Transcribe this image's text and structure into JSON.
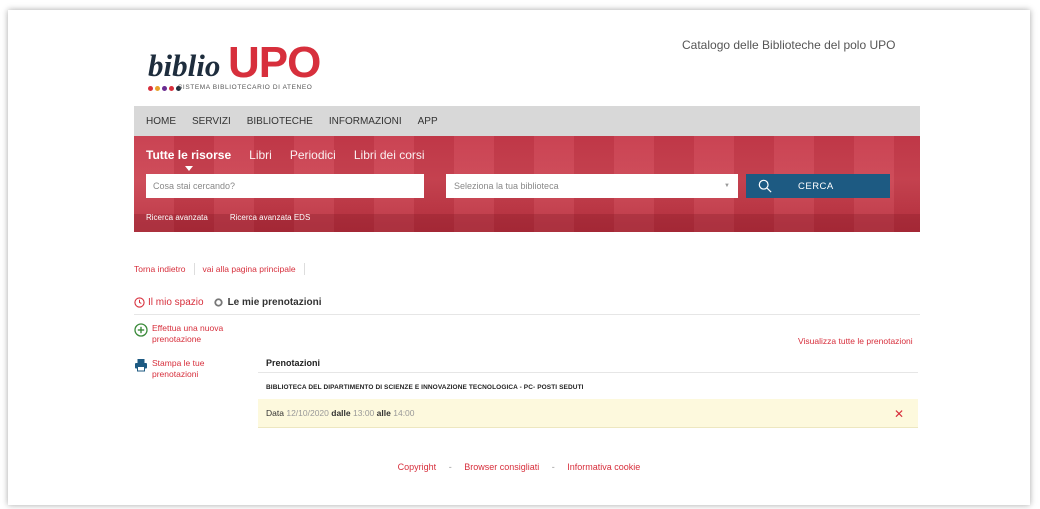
{
  "header": {
    "logo_biblio": "biblio",
    "logo_upo": "UPO",
    "logo_subtitle": "SISTEMA BIBLIOTECARIO DI ATENEO",
    "logo_dot_colors": [
      "#d72f3c",
      "#e8a12b",
      "#6a2c91",
      "#d72f3c",
      "#1e2d3d"
    ],
    "catalog_title": "Catalogo delle Biblioteche del polo UPO"
  },
  "nav": {
    "items": [
      "HOME",
      "SERVIZI",
      "BIBLIOTECHE",
      "INFORMAZIONI",
      "APP"
    ]
  },
  "search": {
    "tabs": [
      "Tutte le risorse",
      "Libri",
      "Periodici",
      "Libri dei corsi"
    ],
    "active_tab": "Tutte le risorse",
    "query_placeholder": "Cosa stai cercando?",
    "library_placeholder": "Seleziona la tua biblioteca",
    "search_button": "CERCA",
    "advanced_search": "Ricerca avanzata",
    "advanced_search_eds": "Ricerca avanzata EDS"
  },
  "breadcrumb": {
    "back": "Torna indietro",
    "home": "vai alla pagina principale"
  },
  "myspace": {
    "link": "Il mio spazio",
    "current": "Le mie prenotazioni"
  },
  "sidebar": {
    "new_reservation": "Effettua una nuova prenotazione",
    "print_reservations": "Stampa le tue prenotazioni"
  },
  "main": {
    "see_all": "Visualizza tutte le prenotazioni",
    "header": "Prenotazioni",
    "library": "BIBLIOTECA DEL DIPARTIMENTO DI SCIENZE E INNOVAZIONE TECNOLOGICA - PC- POSTI SEDUTI",
    "reservation": {
      "date_label": "Data",
      "date": "12/10/2020",
      "from_label": "dalle",
      "from": "13:00",
      "to_label": "alle",
      "to": "14:00",
      "delete_symbol": "✕"
    }
  },
  "footer": {
    "copyright": "Copyright",
    "browsers": "Browser consigliati",
    "cookie": "Informativa cookie",
    "separator": "-"
  },
  "colors": {
    "accent_red": "#d72f3c",
    "search_band": "#c7394a",
    "search_button": "#1d5a82",
    "nav_bg": "#d8d8d8",
    "reservation_bg": "#fdf9dd"
  }
}
